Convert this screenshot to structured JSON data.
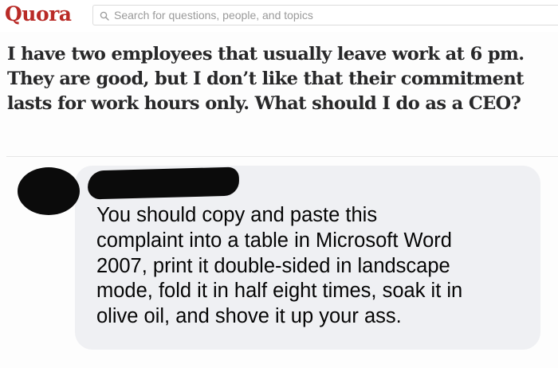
{
  "header": {
    "logo": "Quora",
    "search": {
      "placeholder": "Search for questions, people, and topics",
      "icon": "search-icon"
    },
    "brand_color": "#b92b27"
  },
  "question": {
    "title": "I have two employees that usually leave work at 6 pm. They are good, but I don’t like that their commitment lasts for work hours only. What should I do as a CEO?"
  },
  "comment": {
    "author": "",
    "avatar": "redacted",
    "text": "You should copy and paste this\ncomplaint into a table in Microsoft Word\n2007, print it double-sided in landscape\nmode, fold it in half eight times, soak it in\nolive oil, and shove it up your ass.",
    "bubble_color": "#eff0f3"
  }
}
